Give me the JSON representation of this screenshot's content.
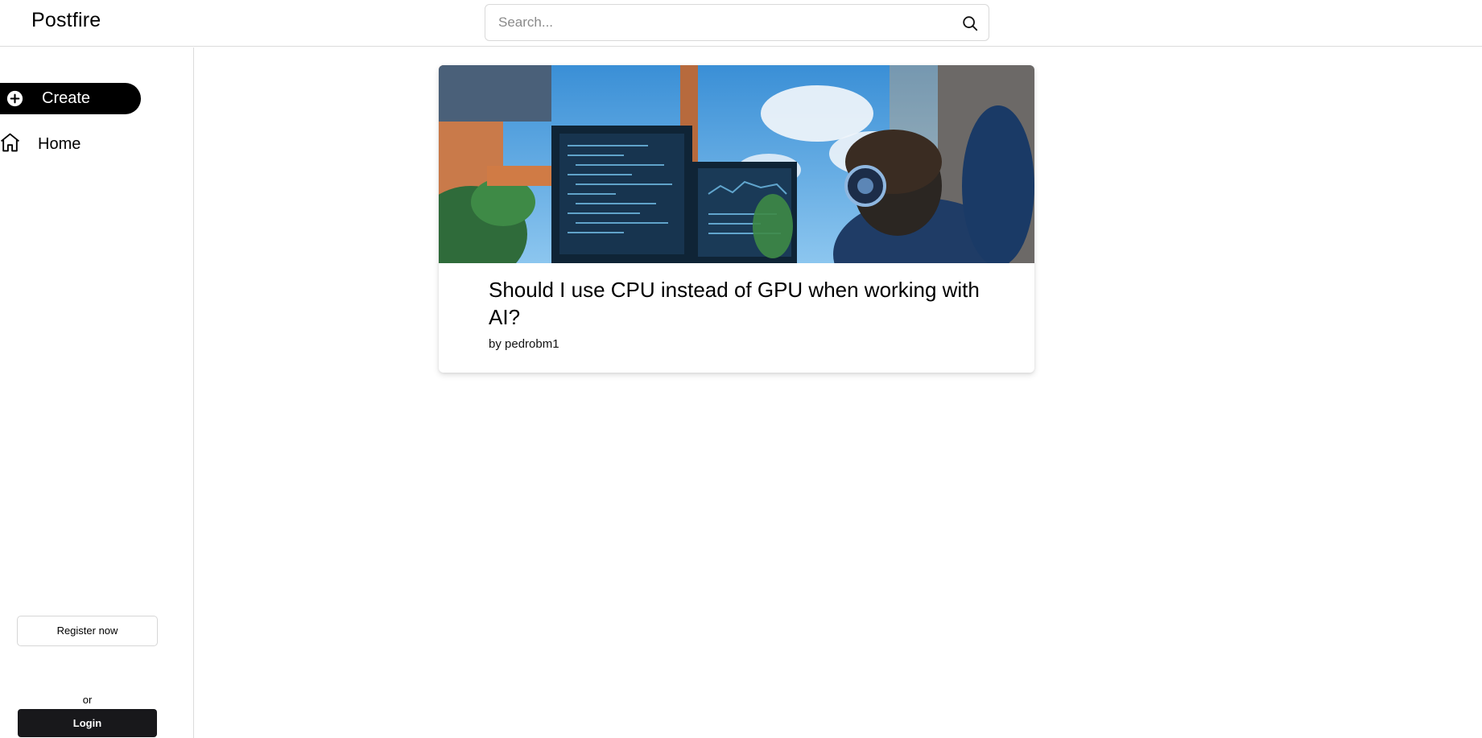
{
  "header": {
    "logo": "Postfire",
    "search": {
      "placeholder": "Search...",
      "value": ""
    },
    "search_icon": "search-icon"
  },
  "sidebar": {
    "create": {
      "label": "Create",
      "icon": "plus-circle-icon"
    },
    "nav": [
      {
        "label": "Home",
        "icon": "home-icon"
      }
    ],
    "auth": {
      "register_label": "Register now",
      "or_text": "or",
      "login_label": "Login"
    }
  },
  "feed": {
    "posts": [
      {
        "title": "Should I use CPU instead of GPU when working with AI?",
        "author": "by pedrobm1",
        "image": "illustration of person with headphones at computer monitors showing code"
      }
    ]
  },
  "colors": {
    "primary": "#000000",
    "login_bg": "#18181b",
    "border": "#dcdcdc"
  }
}
